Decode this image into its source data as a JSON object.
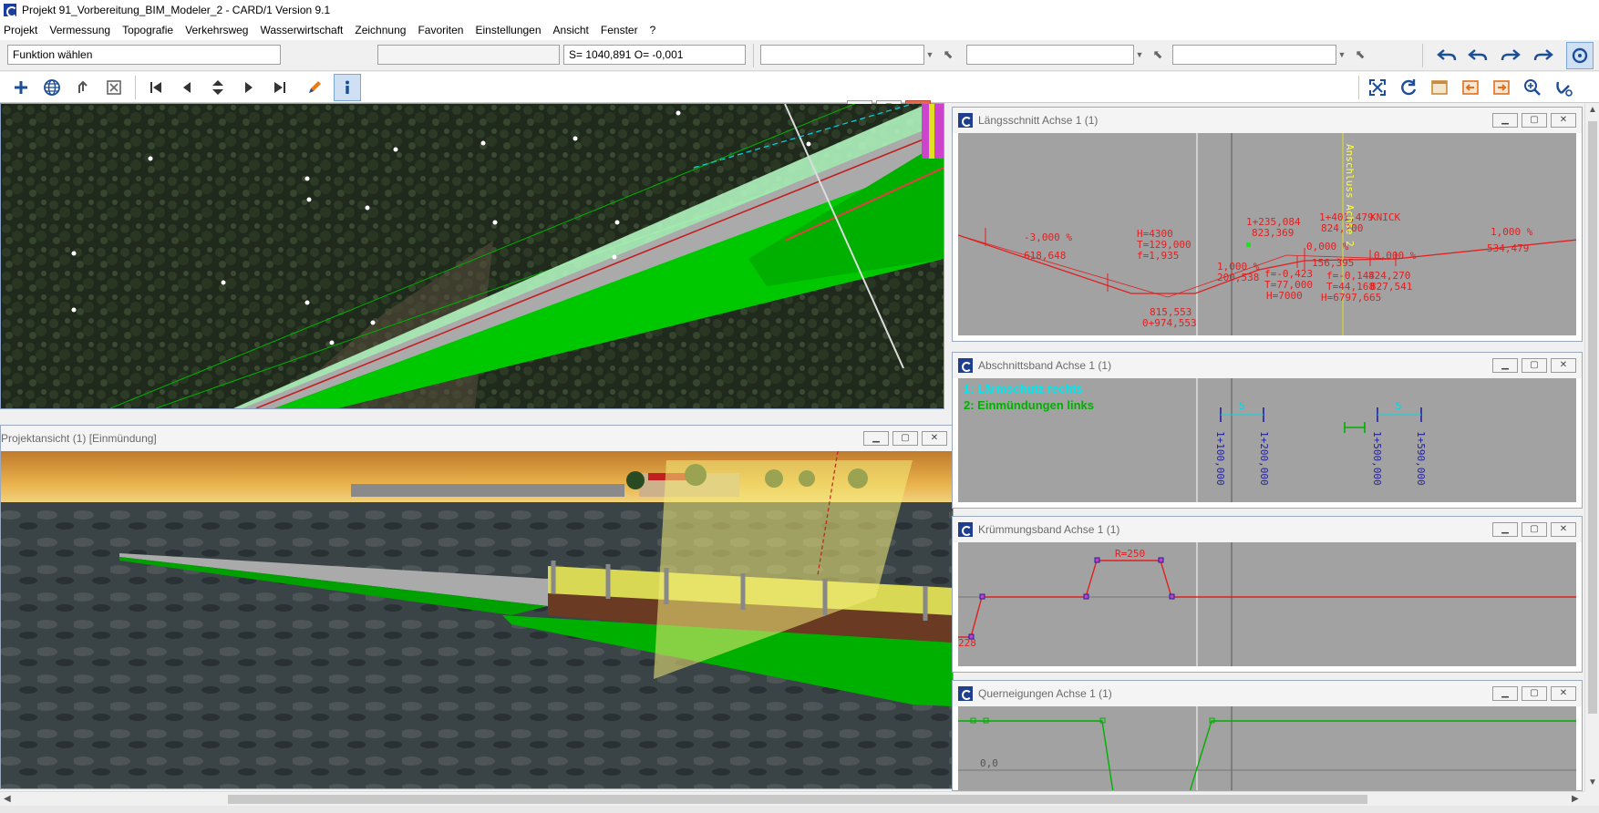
{
  "window": {
    "title": "Projekt 91_Vorbereitung_BIM_Modeler_2 - CARD/1 Version 9.1"
  },
  "menu": [
    "Projekt",
    "Vermessung",
    "Topografie",
    "Verkehrsweg",
    "Wasserwirtschaft",
    "Zeichnung",
    "Favoriten",
    "Einstellungen",
    "Ansicht",
    "Fenster",
    "?"
  ],
  "toolbar": {
    "function_field": "Funktion wählen",
    "empty_field": "",
    "station_readout": "S= 1040,891     O= -0,001",
    "combo1": "",
    "combo2": "",
    "combo3": ""
  },
  "icons": {
    "nav_left": [
      "plus-icon",
      "globe-icon",
      "pointer-icon",
      "close-window-icon",
      "first-icon",
      "prev-icon",
      "updown-icon",
      "next-icon",
      "last-icon",
      "pencil-icon",
      "info-icon"
    ],
    "nav_right": [
      "zoom-extent-icon",
      "refresh-icon",
      "window-icon",
      "import-icon",
      "export-icon",
      "zoom-in-icon",
      "magnet-icon"
    ],
    "history": [
      "undo-icon",
      "undo2-icon",
      "redo-icon",
      "redo2-icon",
      "help-icon"
    ]
  },
  "colors": {
    "accent": "#1b4e97",
    "cad_red": "#e02020",
    "cad_green": "#00a000",
    "cad_cyan": "#00d8e8",
    "cad_yellow": "#ffff40",
    "cad_grey": "#a2a2a2"
  },
  "panels": {
    "project_view": {
      "title": "Projektansicht (1) [Einmündung]"
    },
    "laengsschnitt": {
      "title": "Längsschnitt Achse 1 (1)",
      "labels": {
        "grade1": "-3,000 %",
        "dist1": "618,648",
        "h4300": "H=4300",
        "t129": "T=129,000",
        "f1935": "f=1,935",
        "st815": "815,553",
        "st0974": "0+974,553",
        "st1235": "1+235,084",
        "h823": "823,369",
        "grade2": "1,000 %",
        "dist2": "200,538",
        "f0423": "f=-0,423",
        "t77": "T=77,000",
        "h7000": "H=7000",
        "grade3": "0,000 %",
        "dist3": "156,395",
        "st1401": "1+401,479",
        "h824700": "824,700",
        "knick": "KNICK",
        "grade4": "0,000 %",
        "f0144": "f=-0,144",
        "t44": "T=44,168",
        "h824270": "824,270",
        "h6797": "H=6797,665",
        "h827": "827,541",
        "grade5": "1,000 %",
        "dist5": "534,479",
        "anschluss": "Anschluss Achse 2"
      }
    },
    "abschnitt": {
      "title": "Abschnittsband Achse 1 (1)",
      "legend1": "1: Lärmschutz rechts",
      "legend2": "2: Einmündungen links",
      "mark1": "5",
      "mark2": "5",
      "st1100": "1+100,000",
      "st1200": "1+200,000",
      "st1500": "1+500,000",
      "st1590": "1+590,000"
    },
    "kruemmung": {
      "title": "Krümmungsband Achse 1 (1)",
      "radius": "R=250",
      "left_value": "228"
    },
    "querneigung": {
      "title": "Querneigungen Achse 1 (1)",
      "zero": "0,0"
    }
  }
}
